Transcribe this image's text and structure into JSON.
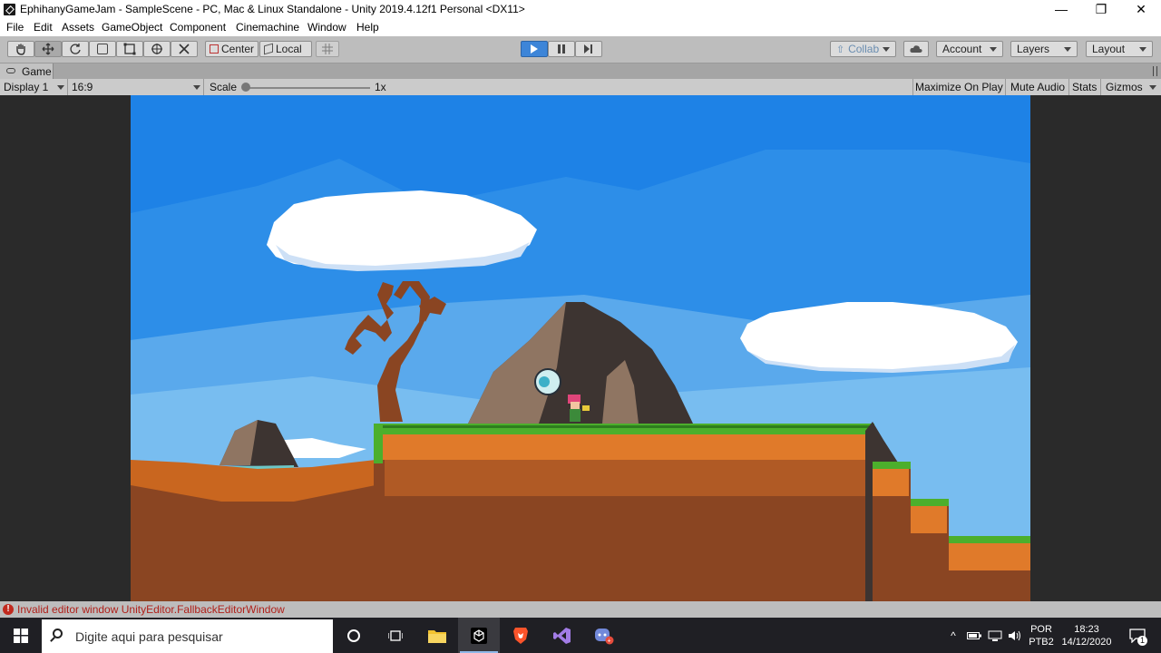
{
  "window": {
    "title": "EphihanyGameJam - SampleScene - PC, Mac & Linux Standalone - Unity 2019.4.12f1 Personal <DX11>",
    "controls": {
      "minimize": "—",
      "restore": "❐",
      "close": "✕"
    }
  },
  "menu": [
    "File",
    "Edit",
    "Assets",
    "GameObject",
    "Component",
    "Cinemachine",
    "Window",
    "Help"
  ],
  "toolbar": {
    "tools": [
      "hand-icon",
      "move-icon",
      "rotate-icon",
      "scale-icon",
      "rect-icon",
      "transform-icon",
      "custom-tool-icon"
    ],
    "pivot_mode": "Center",
    "pivot_rotation": "Local",
    "collab": "Collab",
    "account": "Account",
    "layers": "Layers",
    "layout": "Layout",
    "accent": "#3d85d8"
  },
  "game_tab": {
    "label": "Game"
  },
  "game_controls": {
    "display": "Display 1",
    "aspect": "16:9",
    "scale_label": "Scale",
    "scale_value": "1x",
    "maximize": "Maximize On Play",
    "mute": "Mute Audio",
    "stats": "Stats",
    "gizmos": "Gizmos"
  },
  "status": {
    "message": "Invalid editor window UnityEditor.FallbackEditorWindow",
    "color": "#b0201a"
  },
  "taskbar": {
    "search_placeholder": "Digite aqui para pesquisar",
    "apps": [
      "cortana-icon",
      "task-view-icon",
      "file-explorer-icon",
      "unity-icon",
      "brave-icon",
      "visual-studio-icon",
      "discord-icon"
    ],
    "lang_top": "POR",
    "lang_bottom": "PTB2",
    "time": "18:23",
    "date": "14/12/2020",
    "notifications": "1"
  },
  "scene_colors": {
    "sky": "#1e82e6",
    "sky_light": "#5aa9ec",
    "grass": "#4caf2c",
    "dirt": "#e07a2a",
    "ground_dark": "#8a4522"
  }
}
